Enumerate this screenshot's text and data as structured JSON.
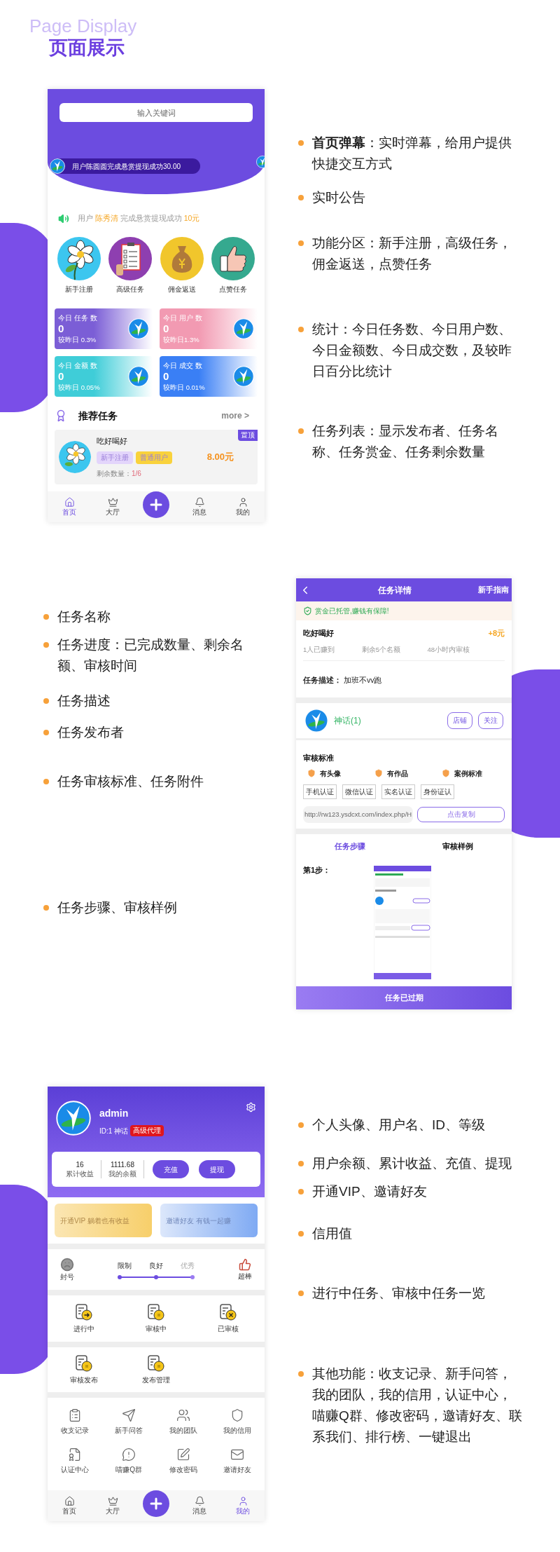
{
  "heading": {
    "subtitle": "Page Display",
    "title": "页面展示"
  },
  "home_screen": {
    "search": {
      "placeholder": "输入关键词"
    },
    "danmaku": "用户陈圆圆完成悬赏提现成功30.00",
    "notice": [
      {
        "text": "用户",
        "highlight": false
      },
      {
        "text": "陈秀清",
        "highlight": true
      },
      {
        "text": "完成悬赏提现成功",
        "highlight": false
      },
      {
        "text": "10元",
        "highlight": true
      }
    ],
    "categories": [
      {
        "label": "新手注册",
        "kind": "flower"
      },
      {
        "label": "高级任务",
        "kind": "clipboard"
      },
      {
        "label": "佣金返送",
        "kind": "moneybag"
      },
      {
        "label": "点赞任务",
        "kind": "thumb"
      }
    ],
    "stats": [
      {
        "title": "今日 任务 数",
        "value": "0",
        "change": "较昨日 0.3%",
        "color": "#7b5ed6"
      },
      {
        "title": "今日 用户 数",
        "value": "0",
        "change": "较昨日1.3%",
        "color": "#f29ab2"
      },
      {
        "title": "今日 金额 数",
        "value": "0",
        "change": "较昨日 0.05%",
        "color": "#3fcdd8"
      },
      {
        "title": "今日 成交 数",
        "value": "0",
        "change": "较昨日 0.01%",
        "color": "#3a7ff5"
      }
    ],
    "section_title": "推荐任务",
    "more": "more >",
    "task": {
      "title": "吃好喝好",
      "tags": [
        {
          "text": "新手注册",
          "color": "#e3d5fb"
        },
        {
          "text": "普通用户",
          "color": "#f9d23c"
        }
      ],
      "remaining_label": "剩余数量：",
      "remaining": "1/6",
      "reward": "8.00元",
      "pin": "置顶"
    },
    "tabbar": [
      {
        "label": "首页",
        "kind": "home",
        "selected": true
      },
      {
        "label": "大厅",
        "kind": "crown",
        "selected": false
      },
      {
        "kind": "add",
        "selected": false
      },
      {
        "label": "消息",
        "kind": "bell",
        "selected": false
      },
      {
        "label": "我的",
        "kind": "person",
        "selected": false
      }
    ]
  },
  "home_features": [
    "**首页弹幕**：实时弹幕，给用户提供快捷交互方式",
    "实时公告",
    "功能分区：新手注册，高级任务，佣金返送，点赞任务",
    "统计：今日任务数、今日用户数、今日金额数、今日成交数，及较昨日百分比统计",
    "任务列表：显示发布者、任务名称、任务赏金、任务剩余数量"
  ],
  "detail_features": [
    "任务名称",
    "任务进度：已完成数量、剩余名额、审核时间",
    "任务描述",
    "任务发布者",
    "任务审核标准、任务附件",
    "任务步骤、审核样例"
  ],
  "detail_screen": {
    "title": "任务详情",
    "guide": "新手指南",
    "guarantee": "赏金已托管,赚钱有保障!",
    "task_title": "吃好喝好",
    "reward": "+8元",
    "progress": [
      "1人已赚到",
      "剩余5个名额",
      "48小时内审核"
    ],
    "description": "**任务描述：** 加班不vv跑",
    "publisher": {
      "name": "神话(1)",
      "buttons": [
        "店铺",
        "关注"
      ]
    },
    "review": {
      "title": "审核标准",
      "criteria": [
        "有头像",
        "有作品",
        "案例标准"
      ],
      "verifications": [
        "手机认证",
        "微信认证",
        "实名认证",
        "身份证认"
      ]
    },
    "link": {
      "value": "http://rw123.ysdcxt.com/index.php/H",
      "button": "点击复制"
    },
    "tabs": [
      {
        "label": "任务步骤",
        "selected": true
      },
      {
        "label": "审核样例",
        "selected": false
      }
    ],
    "step": "第1步：",
    "status_button": "任务已过期"
  },
  "profile_screen": {
    "username": "admin",
    "id": "ID:1 神话",
    "badge": "高级代理",
    "wallet": [
      {
        "value": "16",
        "label": "累计收益"
      },
      {
        "value": "1111.68",
        "label": "我的余额"
      }
    ],
    "actions": [
      "充值",
      "提现"
    ],
    "banners": [
      {
        "text": "开通VIP 躺着也有收益",
        "kind": "vip"
      },
      {
        "text": "邀请好友 有钱一起赚",
        "kind": "invite"
      }
    ],
    "credit": {
      "low": "封号",
      "high": "超棒",
      "levels": [
        {
          "label": "限制",
          "reached": true
        },
        {
          "label": "良好",
          "reached": true
        },
        {
          "label": "优秀",
          "reached": false
        }
      ]
    },
    "task_status": [
      {
        "label": "进行中",
        "kind": "arrow"
      },
      {
        "label": "审核中",
        "kind": "coin"
      },
      {
        "label": "已审核",
        "kind": "cross"
      }
    ],
    "publish": [
      {
        "label": "审核发布",
        "kind": "coin"
      },
      {
        "label": "发布管理",
        "kind": "coin"
      }
    ],
    "menu": [
      {
        "label": "收支记录",
        "kind": "clipboard"
      },
      {
        "label": "新手问答",
        "kind": "plane"
      },
      {
        "label": "我的团队",
        "kind": "team"
      },
      {
        "label": "我的信用",
        "kind": "shield"
      },
      {
        "label": "认证中心",
        "kind": "cert"
      },
      {
        "label": "喵赚Q群",
        "kind": "chat"
      },
      {
        "label": "修改密码",
        "kind": "edit"
      },
      {
        "label": "邀请好友",
        "kind": "mail"
      }
    ],
    "tabbar": [
      {
        "label": "首页",
        "kind": "home",
        "selected": false
      },
      {
        "label": "大厅",
        "kind": "crown",
        "selected": false
      },
      {
        "kind": "add",
        "selected": false
      },
      {
        "label": "消息",
        "kind": "bell",
        "selected": false
      },
      {
        "label": "我的",
        "kind": "person",
        "selected": true
      }
    ]
  },
  "profile_features": [
    "个人头像、用户名、ID、等级",
    "用户余额、累计收益、充值、提现",
    "开通VIP、邀请好友",
    "信用值",
    "进行中任务、审核中任务一览",
    "其他功能：收支记录、新手问答，我的团队，我的信用，认证中心，喵赚Q群、修改密码，邀请好友、联系我们、排行榜、一键退出"
  ]
}
